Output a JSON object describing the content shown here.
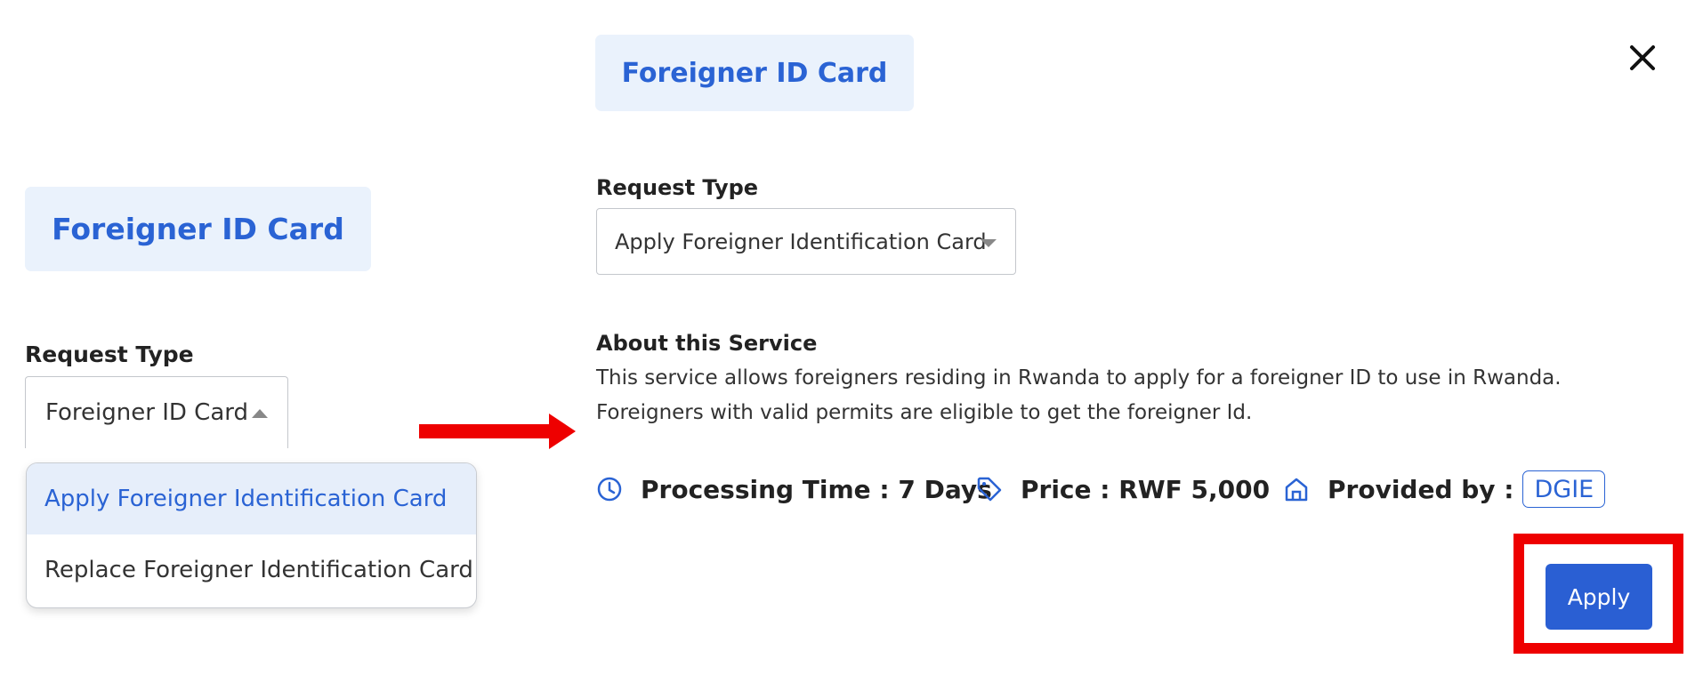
{
  "left_panel": {
    "service_title": "Foreigner ID Card",
    "request_type_label": "Request Type",
    "select_value": "Foreigner ID Card",
    "options": [
      "Apply Foreigner Identification Card",
      "Replace Foreigner Identification Card"
    ]
  },
  "right_panel": {
    "service_title": "Foreigner ID Card",
    "request_type_label": "Request Type",
    "select_value": "Apply Foreigner Identification Card",
    "about_title": "About this Service",
    "about_lines": [
      "This service allows foreigners residing in Rwanda to apply for a foreigner ID to use in Rwanda.",
      "Foreigners with valid permits are eligible to get the foreigner Id."
    ],
    "processing_time": "Processing Time : 7 Days",
    "price": "Price : RWF 5,000",
    "provided_by_label": "Provided by :",
    "provider": "DGIE",
    "apply_label": "Apply"
  },
  "icons": {
    "close": "close-icon",
    "clock": "clock-icon",
    "tag": "tag-icon",
    "home": "home-icon",
    "arrow": "arrow-right-icon"
  },
  "colors": {
    "accent": "#2a63d4",
    "pill_bg": "#eaf2fc",
    "highlight": "#ee0000",
    "apply_bg": "#2a5fd3"
  }
}
